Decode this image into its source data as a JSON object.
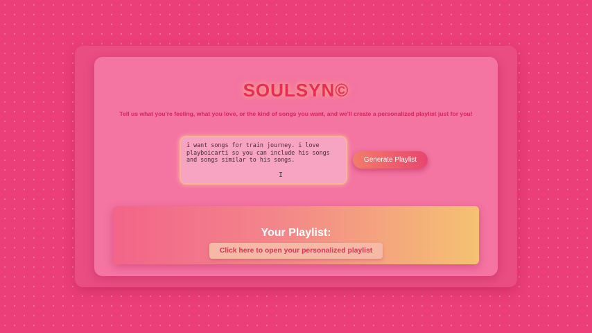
{
  "header": {
    "title": "SOULSYN©",
    "subtitle": "Tell us what you're feeling, what you love, or the kind of songs you want, and we'll create a personalized playlist just for you!"
  },
  "form": {
    "input_value": "i want songs for train journey. i love playboicarti so you can include his songs and songs similar to his songs.",
    "generate_label": "Generate Playlist"
  },
  "playlist": {
    "title": "Your Playlist:",
    "link_label": "Click here to open your personalized playlist"
  },
  "colors": {
    "background": "#ec3f7a",
    "card": "#f474a2",
    "accent": "#e62d5c"
  }
}
